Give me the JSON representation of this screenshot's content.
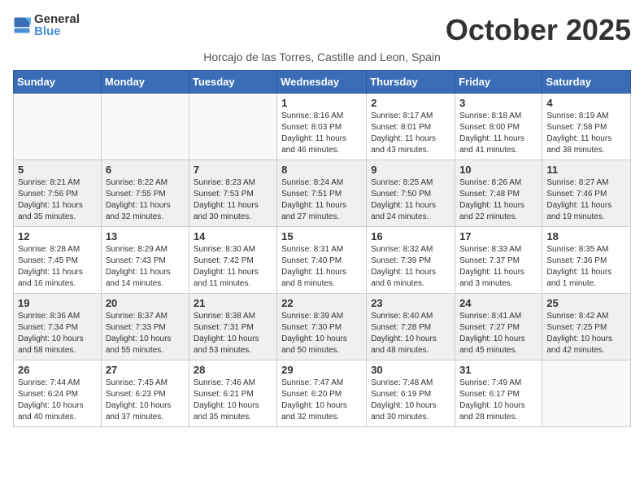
{
  "logo": {
    "text_general": "General",
    "text_blue": "Blue"
  },
  "title": "October 2025",
  "subtitle": "Horcajo de las Torres, Castille and Leon, Spain",
  "headers": [
    "Sunday",
    "Monday",
    "Tuesday",
    "Wednesday",
    "Thursday",
    "Friday",
    "Saturday"
  ],
  "weeks": [
    [
      {
        "day": "",
        "info": ""
      },
      {
        "day": "",
        "info": ""
      },
      {
        "day": "",
        "info": ""
      },
      {
        "day": "1",
        "info": "Sunrise: 8:16 AM\nSunset: 8:03 PM\nDaylight: 11 hours and 46 minutes."
      },
      {
        "day": "2",
        "info": "Sunrise: 8:17 AM\nSunset: 8:01 PM\nDaylight: 11 hours and 43 minutes."
      },
      {
        "day": "3",
        "info": "Sunrise: 8:18 AM\nSunset: 8:00 PM\nDaylight: 11 hours and 41 minutes."
      },
      {
        "day": "4",
        "info": "Sunrise: 8:19 AM\nSunset: 7:58 PM\nDaylight: 11 hours and 38 minutes."
      }
    ],
    [
      {
        "day": "5",
        "info": "Sunrise: 8:21 AM\nSunset: 7:56 PM\nDaylight: 11 hours and 35 minutes."
      },
      {
        "day": "6",
        "info": "Sunrise: 8:22 AM\nSunset: 7:55 PM\nDaylight: 11 hours and 32 minutes."
      },
      {
        "day": "7",
        "info": "Sunrise: 8:23 AM\nSunset: 7:53 PM\nDaylight: 11 hours and 30 minutes."
      },
      {
        "day": "8",
        "info": "Sunrise: 8:24 AM\nSunset: 7:51 PM\nDaylight: 11 hours and 27 minutes."
      },
      {
        "day": "9",
        "info": "Sunrise: 8:25 AM\nSunset: 7:50 PM\nDaylight: 11 hours and 24 minutes."
      },
      {
        "day": "10",
        "info": "Sunrise: 8:26 AM\nSunset: 7:48 PM\nDaylight: 11 hours and 22 minutes."
      },
      {
        "day": "11",
        "info": "Sunrise: 8:27 AM\nSunset: 7:46 PM\nDaylight: 11 hours and 19 minutes."
      }
    ],
    [
      {
        "day": "12",
        "info": "Sunrise: 8:28 AM\nSunset: 7:45 PM\nDaylight: 11 hours and 16 minutes."
      },
      {
        "day": "13",
        "info": "Sunrise: 8:29 AM\nSunset: 7:43 PM\nDaylight: 11 hours and 14 minutes."
      },
      {
        "day": "14",
        "info": "Sunrise: 8:30 AM\nSunset: 7:42 PM\nDaylight: 11 hours and 11 minutes."
      },
      {
        "day": "15",
        "info": "Sunrise: 8:31 AM\nSunset: 7:40 PM\nDaylight: 11 hours and 8 minutes."
      },
      {
        "day": "16",
        "info": "Sunrise: 8:32 AM\nSunset: 7:39 PM\nDaylight: 11 hours and 6 minutes."
      },
      {
        "day": "17",
        "info": "Sunrise: 8:33 AM\nSunset: 7:37 PM\nDaylight: 11 hours and 3 minutes."
      },
      {
        "day": "18",
        "info": "Sunrise: 8:35 AM\nSunset: 7:36 PM\nDaylight: 11 hours and 1 minute."
      }
    ],
    [
      {
        "day": "19",
        "info": "Sunrise: 8:36 AM\nSunset: 7:34 PM\nDaylight: 10 hours and 58 minutes."
      },
      {
        "day": "20",
        "info": "Sunrise: 8:37 AM\nSunset: 7:33 PM\nDaylight: 10 hours and 55 minutes."
      },
      {
        "day": "21",
        "info": "Sunrise: 8:38 AM\nSunset: 7:31 PM\nDaylight: 10 hours and 53 minutes."
      },
      {
        "day": "22",
        "info": "Sunrise: 8:39 AM\nSunset: 7:30 PM\nDaylight: 10 hours and 50 minutes."
      },
      {
        "day": "23",
        "info": "Sunrise: 8:40 AM\nSunset: 7:28 PM\nDaylight: 10 hours and 48 minutes."
      },
      {
        "day": "24",
        "info": "Sunrise: 8:41 AM\nSunset: 7:27 PM\nDaylight: 10 hours and 45 minutes."
      },
      {
        "day": "25",
        "info": "Sunrise: 8:42 AM\nSunset: 7:25 PM\nDaylight: 10 hours and 42 minutes."
      }
    ],
    [
      {
        "day": "26",
        "info": "Sunrise: 7:44 AM\nSunset: 6:24 PM\nDaylight: 10 hours and 40 minutes."
      },
      {
        "day": "27",
        "info": "Sunrise: 7:45 AM\nSunset: 6:23 PM\nDaylight: 10 hours and 37 minutes."
      },
      {
        "day": "28",
        "info": "Sunrise: 7:46 AM\nSunset: 6:21 PM\nDaylight: 10 hours and 35 minutes."
      },
      {
        "day": "29",
        "info": "Sunrise: 7:47 AM\nSunset: 6:20 PM\nDaylight: 10 hours and 32 minutes."
      },
      {
        "day": "30",
        "info": "Sunrise: 7:48 AM\nSunset: 6:19 PM\nDaylight: 10 hours and 30 minutes."
      },
      {
        "day": "31",
        "info": "Sunrise: 7:49 AM\nSunset: 6:17 PM\nDaylight: 10 hours and 28 minutes."
      },
      {
        "day": "",
        "info": ""
      }
    ]
  ]
}
